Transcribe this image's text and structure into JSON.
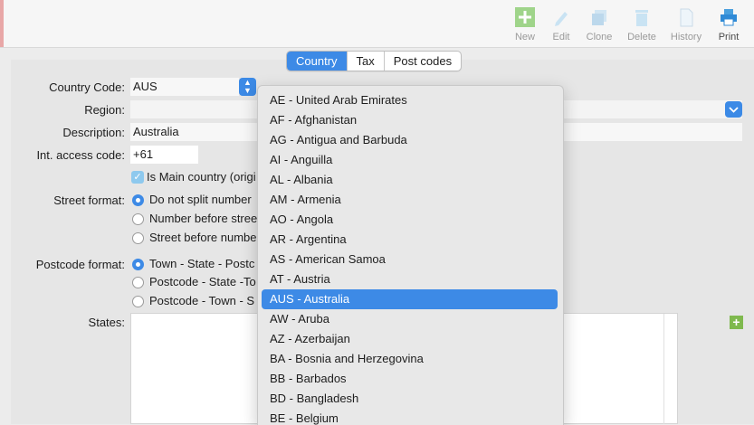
{
  "toolbar": {
    "new": "New",
    "edit": "Edit",
    "clone": "Clone",
    "delete": "Delete",
    "history": "History",
    "print": "Print"
  },
  "tabs": [
    "Country",
    "Tax",
    "Post codes"
  ],
  "form": {
    "country_code_label": "Country Code:",
    "country_code_value": "AUS",
    "region_label": "Region:",
    "description_label": "Description:",
    "description_value": "Australia",
    "int_access_label": "Int. access code:",
    "int_access_value": "+61",
    "main_country_label": "Is Main country (origi",
    "street_format_label": "Street format:",
    "street_options": [
      "Do not split number",
      "Number before stree",
      "Street before numbe"
    ],
    "postcode_format_label": "Postcode format:",
    "postcode_options": [
      "Town - State - Postc",
      "Postcode - State -To",
      "Postcode - Town - S"
    ],
    "states_label": "States:"
  },
  "country_menu": {
    "items": [
      "AE - United Arab Emirates",
      "AF - Afghanistan",
      "AG - Antigua and Barbuda",
      "AI - Anguilla",
      "AL - Albania",
      "AM - Armenia",
      "AO - Angola",
      "AR - Argentina",
      "AS - American Samoa",
      "AT - Austria",
      "AUS - Australia",
      "AW - Aruba",
      "AZ - Azerbaijan",
      "BA - Bosnia and Herzegovina",
      "BB - Barbados",
      "BD - Bangladesh",
      "BE - Belgium"
    ],
    "selected": "AUS - Australia"
  },
  "colors": {
    "accent": "#3d8ae6",
    "add_green": "#7fb94e"
  }
}
